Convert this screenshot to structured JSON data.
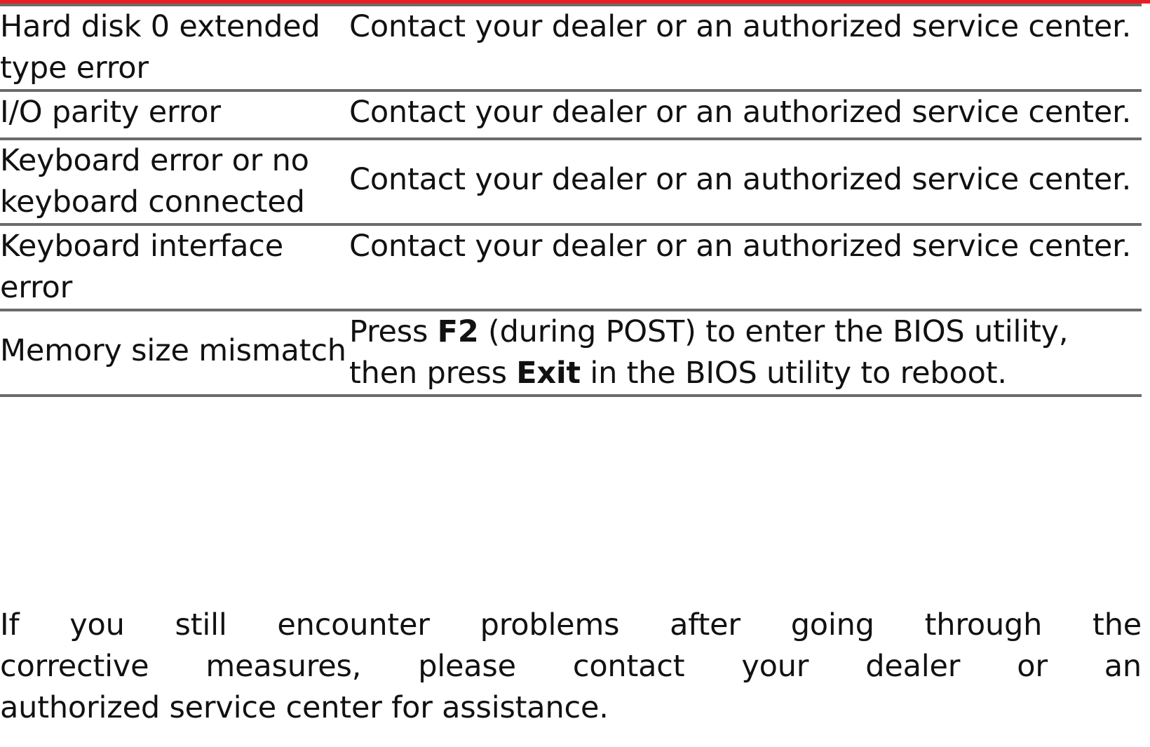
{
  "decor": {
    "accent_color": "#ec1c24",
    "rule_color": "#6b6b6b"
  },
  "table": {
    "rows": [
      {
        "cause": "Hard disk 0 extended type error",
        "action": "Contact your dealer or an authorized service center.",
        "action_parts": [
          {
            "text": "Contact your dealer or an authorized service center.",
            "bold": false
          }
        ]
      },
      {
        "cause": "I/O parity error",
        "action": "Contact your dealer or an authorized service center.",
        "action_parts": [
          {
            "text": "Contact your dealer or an authorized service center.",
            "bold": false
          }
        ]
      },
      {
        "cause": "Keyboard error or no keyboard connected",
        "action": "Contact your dealer or an authorized service center.",
        "action_parts": [
          {
            "text": "Contact your dealer or an authorized service center.",
            "bold": false
          }
        ]
      },
      {
        "cause": "Keyboard interface error",
        "action": "Contact your dealer or an authorized service center.",
        "action_parts": [
          {
            "text": "Contact your dealer or an authorized service center.",
            "bold": false
          }
        ]
      },
      {
        "cause": "Memory size mismatch",
        "action": "Press F2 (during POST) to enter the BIOS utility, then press Exit in the BIOS utility to reboot.",
        "action_parts": [
          {
            "text": "Press ",
            "bold": false
          },
          {
            "text": "F2",
            "bold": true
          },
          {
            "text": " (during POST) to enter the BIOS utility, then press ",
            "bold": false
          },
          {
            "text": "Exit",
            "bold": true
          },
          {
            "text": " in the BIOS utility to reboot.",
            "bold": false
          }
        ]
      }
    ]
  },
  "closing_paragraph": {
    "full_text": "If you still encounter problems after going through the corrective measures, please contact your dealer or an authorized service center for assistance.",
    "lines": [
      "If you still encounter problems after going through the",
      "corrective measures, please contact your dealer or an",
      "authorized service center for assistance."
    ]
  }
}
